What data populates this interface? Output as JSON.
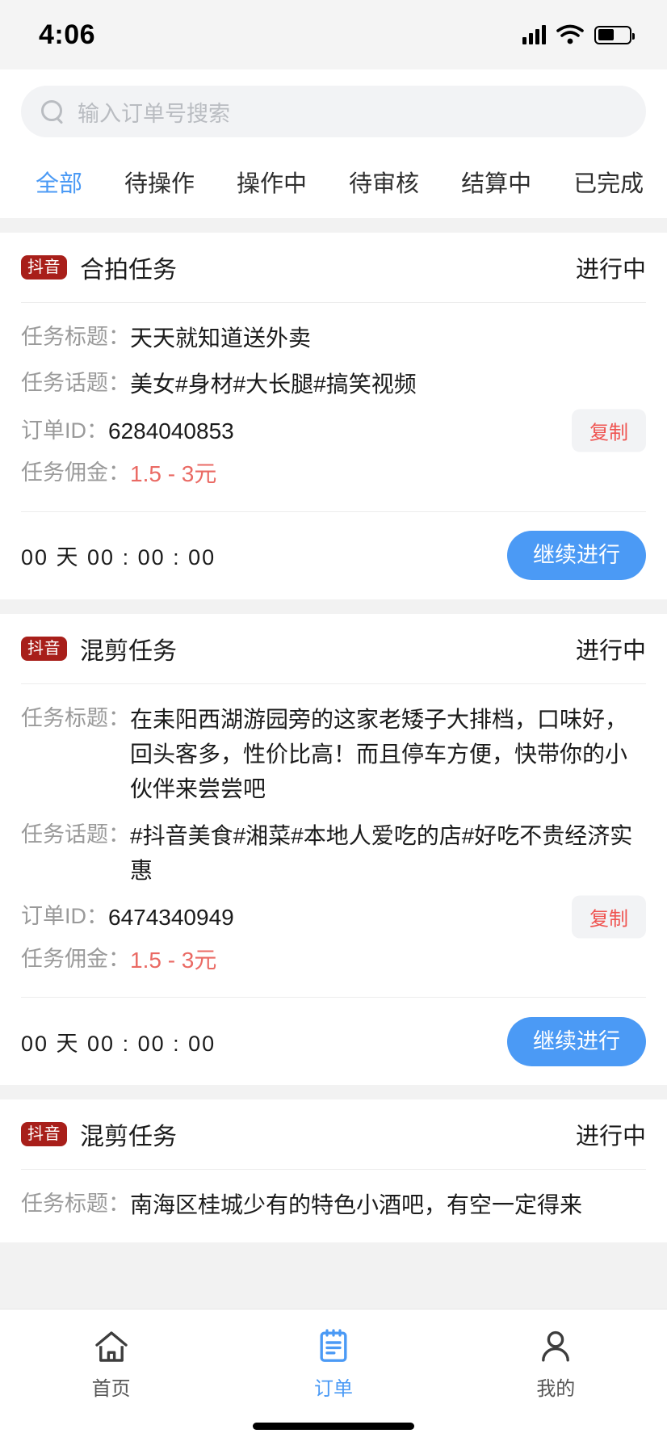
{
  "status_bar": {
    "time": "4:06",
    "signal_icon": "cellular-signal-icon",
    "wifi_icon": "wifi-icon",
    "battery_icon": "battery-icon"
  },
  "search": {
    "placeholder": "输入订单号搜索",
    "value": "",
    "icon": "search-icon"
  },
  "tabs": [
    {
      "label": "全部",
      "active": true
    },
    {
      "label": "待操作",
      "active": false
    },
    {
      "label": "操作中",
      "active": false
    },
    {
      "label": "待审核",
      "active": false
    },
    {
      "label": "结算中",
      "active": false
    },
    {
      "label": "已完成",
      "active": false
    }
  ],
  "labels": {
    "task_title": "任务标题：",
    "task_topic": "任务话题：",
    "order_id": "订单ID：",
    "commission": "任务佣金：",
    "copy": "复制",
    "action": "继续进行",
    "platform_badge": "抖音"
  },
  "colors": {
    "accent_blue": "#4b9af5",
    "badge_red": "#a81f1a",
    "money_red": "#ea6a64",
    "copy_red": "#ef5350",
    "page_bg": "#f2f2f2"
  },
  "orders": [
    {
      "badge": "抖音",
      "type": "合拍任务",
      "status": "进行中",
      "title": "天天就知道送外卖",
      "topic": "美女#身材#大长腿#搞笑视频",
      "order_id": "6284040853",
      "commission": "1.5 - 3元",
      "copy_label": "复制",
      "countdown": "00 天 00 : 00 : 00",
      "action": "继续进行"
    },
    {
      "badge": "抖音",
      "type": "混剪任务",
      "status": "进行中",
      "title": "在耒阳西湖游园旁的这家老矮子大排档，口味好，回头客多，性价比高！而且停车方便，快带你的小伙伴来尝尝吧",
      "topic": "#抖音美食#湘菜#本地人爱吃的店#好吃不贵经济实惠",
      "order_id": "6474340949",
      "commission": "1.5 - 3元",
      "copy_label": "复制",
      "countdown": "00 天 00 : 00 : 00",
      "action": "继续进行"
    },
    {
      "badge": "抖音",
      "type": "混剪任务",
      "status": "进行中",
      "title": "南海区桂城少有的特色小酒吧，有空一定得来"
    }
  ],
  "bottom_nav": [
    {
      "label": "首页",
      "icon": "home-icon",
      "active": false
    },
    {
      "label": "订单",
      "icon": "clipboard-icon",
      "active": true
    },
    {
      "label": "我的",
      "icon": "person-icon",
      "active": false
    }
  ]
}
